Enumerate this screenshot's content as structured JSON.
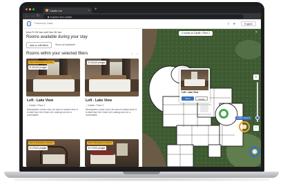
{
  "browser": {
    "tab_title": "Castle Inn",
    "new_tab": "+",
    "tab_close": "×",
    "url": "■ explore-the-castle",
    "nav_back": "←",
    "nav_forward": "→",
    "nav_reload": "↻"
  },
  "header": {
    "logo": "3",
    "powered_by": "Powered by Castle",
    "language": "English"
  },
  "left": {
    "dates": "from Fri 26 Jan until Sun 28 Jan",
    "available_title": "Rooms available during your stay",
    "add_filters": "Add or edit filters",
    "show_all": "Show all available",
    "within_title": "Rooms within your selected filters",
    "prev": "‹",
    "next": "›",
    "cards": [
      {
        "badge": "Bed & Breakfast included",
        "price": "€ 215,00 p/night",
        "name": "Loft - Lake View",
        "location": "Castle • Floor 2",
        "description": "Atmospheric corner room. An area of surface area, it is ideal from the Great Loft, making room for a comfortable"
      },
      {
        "badge": "",
        "price": "€ 215,00 p/night",
        "name": "Loft - Lake View",
        "location": "Castle • Floor 2",
        "description": "Atmospheric corner room. An area of surface area, it is ideal from the Great Loft, making room for a comfortable"
      },
      {
        "badge": "Bed & Breakfast included",
        "price": "€ 175,00 p/night"
      },
      {
        "badge": "Bed & Breakfast included",
        "price": "€ 175,00 p/night"
      }
    ]
  },
  "map": {
    "rooms_pill": "4 rooms on Castle • Floor 2",
    "close": "×",
    "popup_name": "Loft - Lake View",
    "popup_book": "Book",
    "popup_details": "Details",
    "castle_tag": "Castle • Floor 2",
    "zoom_in": "+",
    "zoom_out": "−"
  },
  "colors": {
    "accent": "#3b6fb6",
    "badge": "#f0b429",
    "lawn": "#3e5a32",
    "pin_green": "#2e9e3c",
    "pin_orange": "#f0a02a",
    "pin_blue": "#3b6fb6"
  }
}
